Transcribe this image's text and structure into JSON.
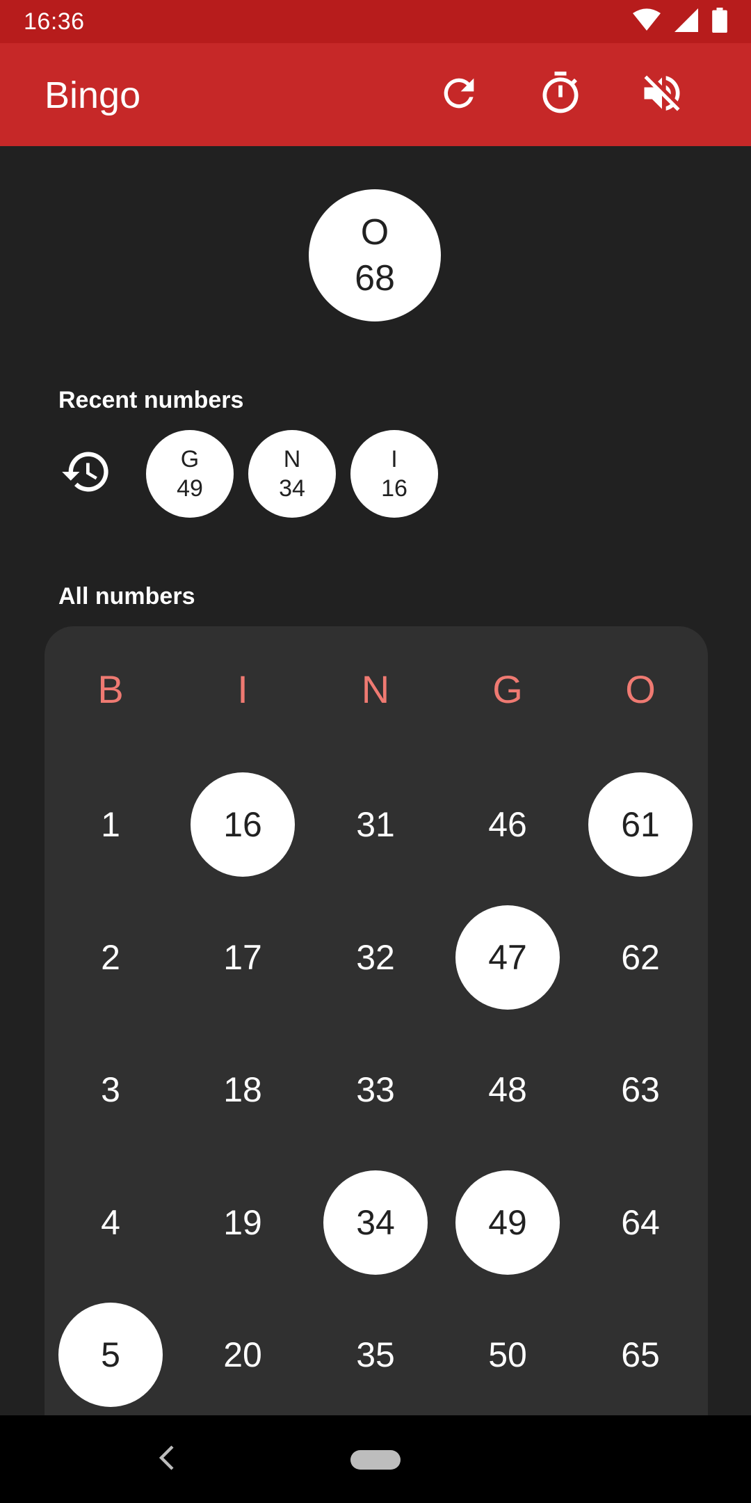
{
  "status_bar": {
    "time": "16:36",
    "icons": [
      "wifi-icon",
      "signal-icon",
      "battery-icon"
    ]
  },
  "app_bar": {
    "title": "Bingo",
    "actions": [
      "refresh-icon",
      "timer-icon",
      "volume-off-icon"
    ],
    "color": "#c62828",
    "status_color": "#b71c1c"
  },
  "current_ball": {
    "letter": "O",
    "number": "68"
  },
  "recent": {
    "label": "Recent numbers",
    "icon": "history-icon",
    "balls": [
      {
        "letter": "G",
        "number": "49"
      },
      {
        "letter": "N",
        "number": "34"
      },
      {
        "letter": "I",
        "number": "16"
      }
    ]
  },
  "all_numbers": {
    "label": "All numbers",
    "header_color": "#ef7a72",
    "columns": [
      {
        "letter": "B",
        "cells": [
          {
            "n": "1",
            "called": false
          },
          {
            "n": "2",
            "called": false
          },
          {
            "n": "3",
            "called": false
          },
          {
            "n": "4",
            "called": false
          },
          {
            "n": "5",
            "called": true
          }
        ]
      },
      {
        "letter": "I",
        "cells": [
          {
            "n": "16",
            "called": true
          },
          {
            "n": "17",
            "called": false
          },
          {
            "n": "18",
            "called": false
          },
          {
            "n": "19",
            "called": false
          },
          {
            "n": "20",
            "called": false
          }
        ]
      },
      {
        "letter": "N",
        "cells": [
          {
            "n": "31",
            "called": false
          },
          {
            "n": "32",
            "called": false
          },
          {
            "n": "33",
            "called": false
          },
          {
            "n": "34",
            "called": true
          },
          {
            "n": "35",
            "called": false
          }
        ]
      },
      {
        "letter": "G",
        "cells": [
          {
            "n": "46",
            "called": false
          },
          {
            "n": "47",
            "called": true
          },
          {
            "n": "48",
            "called": false
          },
          {
            "n": "49",
            "called": true
          },
          {
            "n": "50",
            "called": false
          }
        ]
      },
      {
        "letter": "O",
        "cells": [
          {
            "n": "61",
            "called": true
          },
          {
            "n": "62",
            "called": false
          },
          {
            "n": "63",
            "called": false
          },
          {
            "n": "64",
            "called": false
          },
          {
            "n": "65",
            "called": false
          }
        ]
      }
    ]
  },
  "nav_bar": {
    "icons": [
      "back-icon",
      "home-pill-icon"
    ]
  }
}
